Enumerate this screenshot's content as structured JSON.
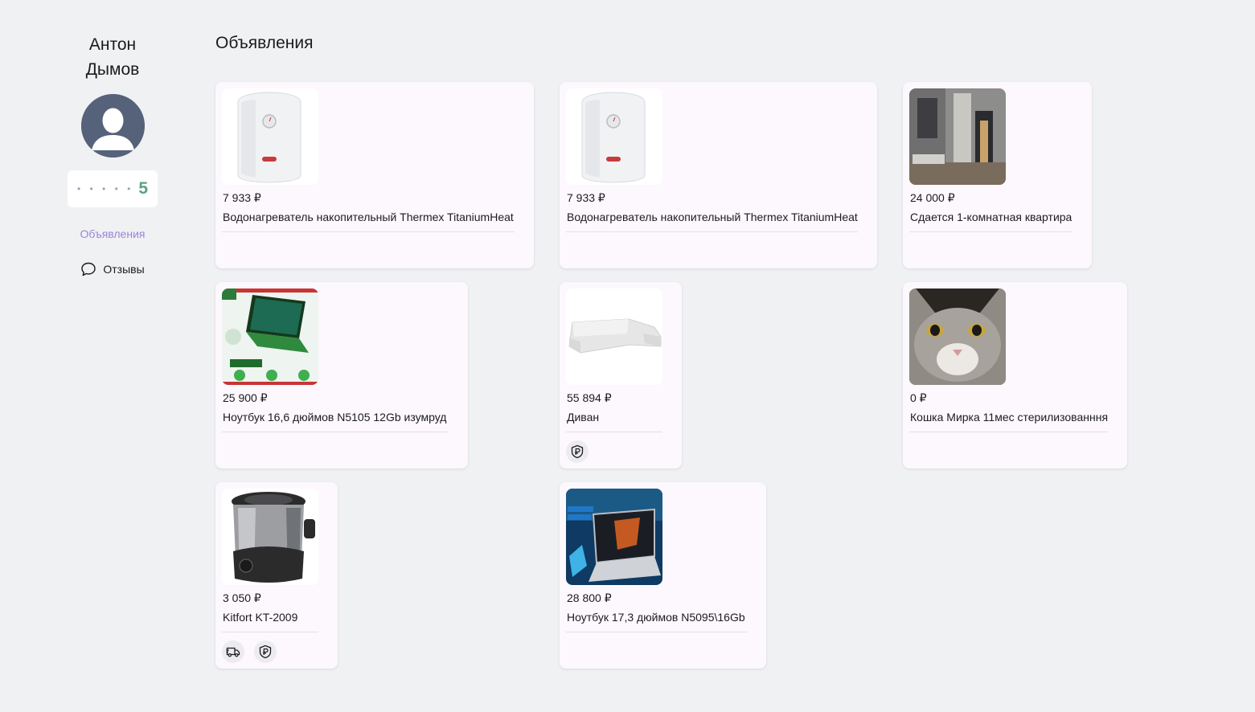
{
  "profile": {
    "first_name": "Антон",
    "last_name": "Дымов",
    "rating_dots": "• • • • •",
    "rating_value": "5"
  },
  "nav": {
    "ads_label": "Объявления",
    "reviews_label": "Отзывы"
  },
  "page": {
    "title": "Объявления"
  },
  "listings": [
    {
      "price": "7 933 ₽",
      "title": "Водонагреватель накопительный Thermex TitaniumHeat",
      "image": "water-heater"
    },
    {
      "price": "7 933 ₽",
      "title": "Водонагреватель накопительный Thermex TitaniumHeat",
      "image": "water-heater"
    },
    {
      "price": "24 000 ₽",
      "title": "Сдается 1-комнатная квартира",
      "image": "apartment-room"
    },
    {
      "price": "25 900 ₽",
      "title": "Ноутбук 16,6 дюймов N5105 12Gb изумруд",
      "image": "green-laptop"
    },
    {
      "price": "55 894 ₽",
      "title": "Диван",
      "image": "sofa",
      "badges": [
        "ruble-protection-icon"
      ]
    },
    {
      "price": "0 ₽",
      "title": "Кошка Мирка 11мес стерилизованння",
      "image": "cat"
    },
    {
      "price": "3 050 ₽",
      "title": "Kitfort KT-2009",
      "image": "deep-fryer",
      "badges": [
        "delivery-truck-icon",
        "ruble-protection-icon"
      ]
    },
    {
      "price": "28 800 ₽",
      "title": "Ноутбук 17,3 дюймов N5095\\16Gb",
      "image": "laptop"
    }
  ],
  "colors": {
    "background": "#f0f1f3",
    "card": "#fdf8fd",
    "rating": "#5aa283",
    "active_nav": "#9a85d4",
    "avatar": "#56627a"
  }
}
